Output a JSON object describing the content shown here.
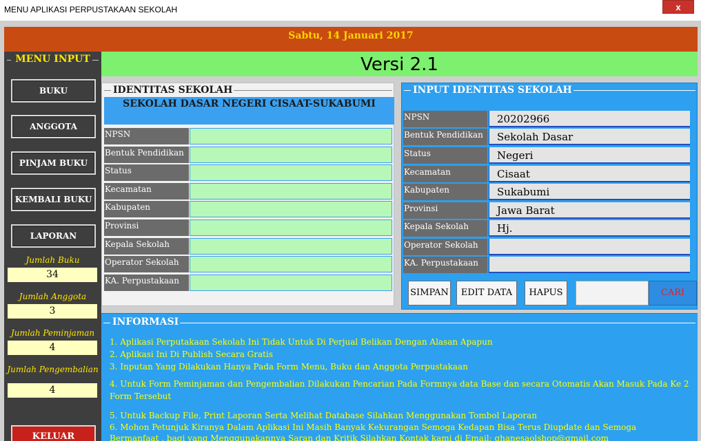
{
  "window": {
    "title": "MENU APLIKASI PERPUSTAKAAN SEKOLAH",
    "close_label": "x"
  },
  "header": {
    "date": "Sabtu, 14 Januari 2017",
    "version": "Versi 2.1"
  },
  "menu": {
    "legend": "MENU INPUT",
    "buttons": [
      "BUKU",
      "ANGGOTA",
      "PINJAM BUKU",
      "KEMBALI BUKU",
      "LAPORAN"
    ],
    "stats": [
      {
        "label": "Jumlah Buku",
        "value": "34"
      },
      {
        "label": "Jumlah Anggota",
        "value": "3"
      },
      {
        "label": "Jumlah Peminjaman",
        "value": "4"
      },
      {
        "label": "Jumlah Pengembalian",
        "value": "4"
      }
    ],
    "exit_label": "KELUAR"
  },
  "identitas": {
    "legend": "IDENTITAS SEKOLAH",
    "school_name": "SEKOLAH DASAR NEGERI CISAAT-SUKABUMI",
    "labels": [
      "NPSN",
      "Bentuk Pendidikan",
      "Status",
      "Kecamatan",
      "Kabupaten",
      "Provinsi",
      "Kepala Sekolah",
      "Operator Sekolah",
      "KA. Perpustakaan"
    ]
  },
  "input_identitas": {
    "legend": "INPUT IDENTITAS SEKOLAH",
    "fields": [
      {
        "label": "NPSN",
        "value": "20202966"
      },
      {
        "label": "Bentuk Pendidikan",
        "value": "Sekolah Dasar"
      },
      {
        "label": "Status",
        "value": "Negeri"
      },
      {
        "label": "Kecamatan",
        "value": "Cisaat"
      },
      {
        "label": "Kabupaten",
        "value": "Sukabumi"
      },
      {
        "label": "Provinsi",
        "value": "Jawa Barat"
      },
      {
        "label": "Kepala Sekolah",
        "value": "Hj."
      },
      {
        "label": "Operator Sekolah",
        "value": ""
      },
      {
        "label": "KA. Perpustakaan",
        "value": ""
      }
    ],
    "buttons": {
      "save": "SIMPAN",
      "edit": "EDIT DATA",
      "delete": "HAPUS",
      "search": "CARI"
    }
  },
  "informasi": {
    "legend": "INFORMASI",
    "lines": [
      "1. Aplikasi Perputakaan Sekolah Ini Tidak Untuk Di Perjual Belikan Dengan Alasan Apapun",
      "2. Aplikasi Ini Di Publish Secara Gratis",
      "3. Inputan Yang Dilakukan Hanya Pada Form Menu, Buku dan Anggota Perpustakaan",
      "4. Untuk Form Peminjaman dan Pengembalian Dilakukan Pencarian Pada Formnya data Base dan secara Otomatis Akan Masuk Pada Ke 2",
      "Form Tersebut",
      "5. Untuk Backup File, Print Laporan Serta Melihat Database Silahkan Menggunakan Tombol Laporan",
      "6. Mohon Petunjuk Kiranya Dalam Aplikasi Ini Masih Banyak Kekurangan Semoga Kedapan Bisa Terus Diupdate dan Semoga",
      "Bermanfaat , bagi yang Menggunakannya Saran dan Kritik Silahkan Kontak kami di Email: ghanesaolshop@gmail.com"
    ]
  }
}
